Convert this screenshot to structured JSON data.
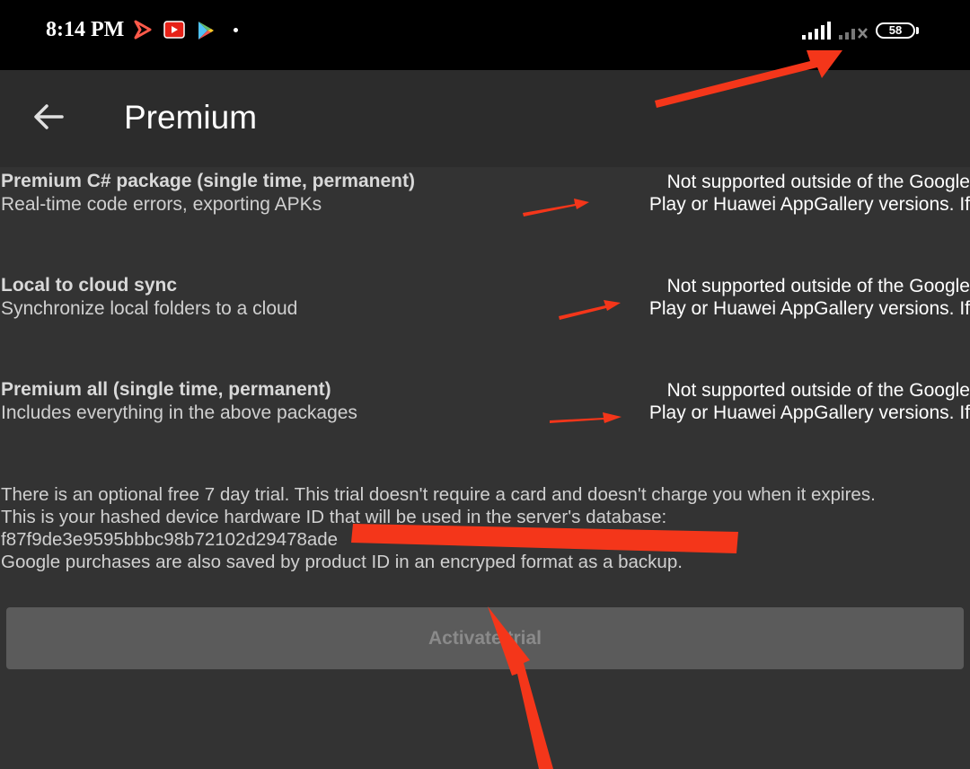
{
  "status_bar": {
    "time": "8:14 PM",
    "battery": "58",
    "icons": [
      "play-arrow-icon",
      "youtube-icon",
      "play-store-icon",
      "dot-icon",
      "signal-icon",
      "signal-off-icon",
      "battery-icon"
    ]
  },
  "toolbar": {
    "back_icon": "arrow-left-icon",
    "title": "Premium"
  },
  "packages": [
    {
      "title": "Premium C# package (single time, permanent)",
      "description": "Real-time code errors, exporting APKs",
      "status_line1": "Not supported outside of the Google",
      "status_line2": "Play or Huawei AppGallery versions. If"
    },
    {
      "title": "Local to cloud sync",
      "description": "Synchronize local folders to a cloud",
      "status_line1": "Not supported outside of the Google",
      "status_line2": "Play or Huawei AppGallery versions. If"
    },
    {
      "title": "Premium all (single time, permanent)",
      "description": "Includes everything in the above packages",
      "status_line1": "Not supported outside of the Google",
      "status_line2": "Play or Huawei AppGallery versions. If"
    }
  ],
  "info": {
    "line1": "There is an optional free 7 day trial. This trial doesn't require a card and doesn't charge you when it expires.",
    "line2": "This is your hashed device hardware ID that will be used in the server's database:",
    "line3": "f87f9de3e9595bbbc98b72102d29478ade",
    "line4": "Google purchases are also saved by product ID in an encryped format as a backup."
  },
  "actions": {
    "activate_trial": "Activate trial"
  },
  "colors": {
    "background": "#333333",
    "toolbar": "#2c2c2c",
    "status_bar": "#000000",
    "button": "#5b5b5b",
    "annotation": "#f4361a"
  }
}
